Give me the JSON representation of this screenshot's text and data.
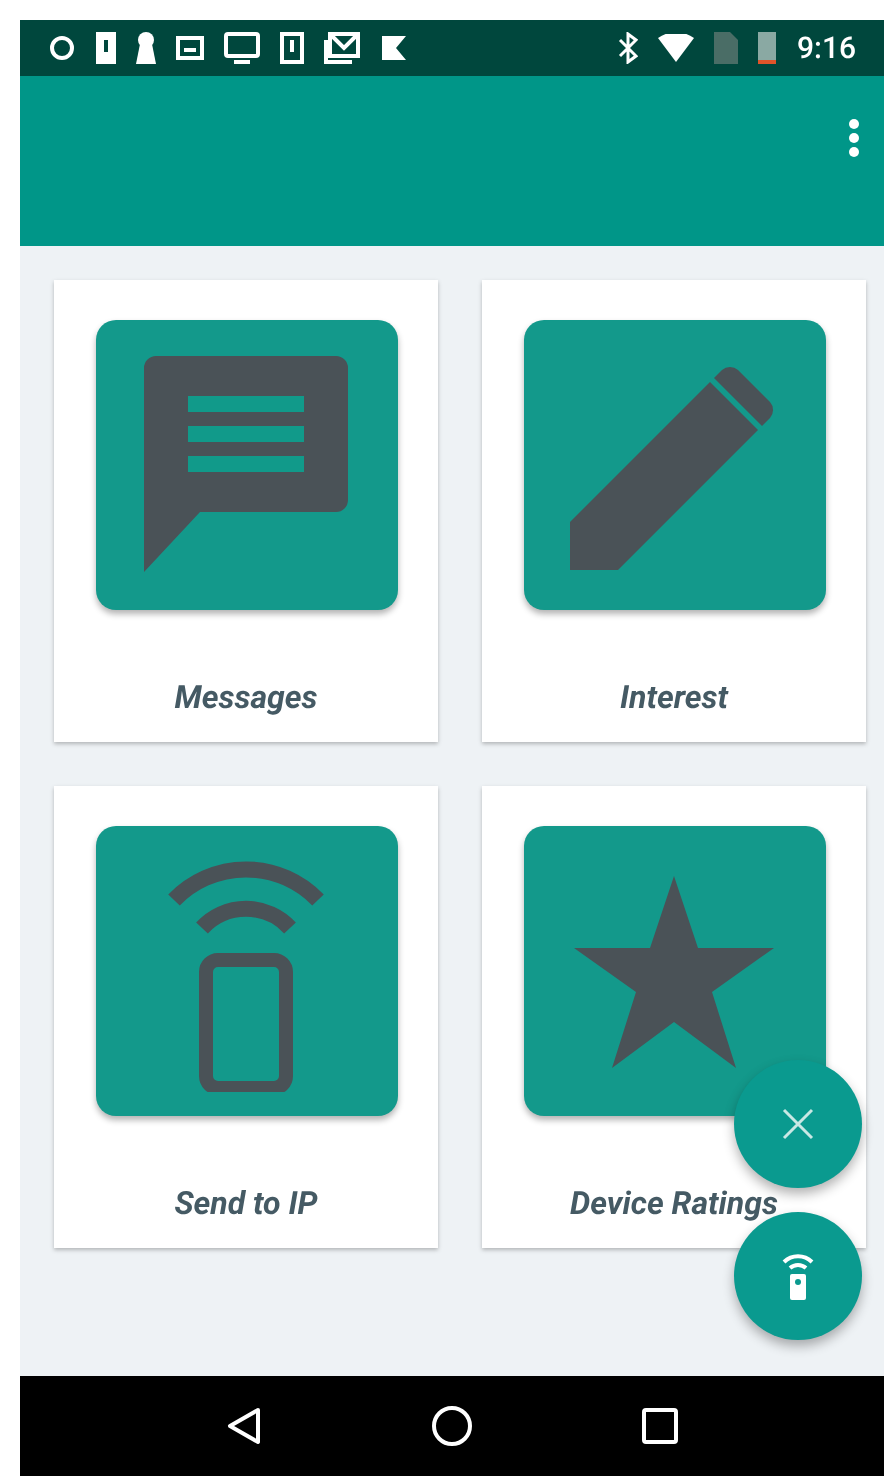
{
  "status_bar": {
    "time": "9:16"
  },
  "tiles": [
    {
      "kind": "messages",
      "label": "Messages"
    },
    {
      "kind": "edit",
      "label": "Interest"
    },
    {
      "kind": "signal",
      "label": "Send to IP"
    },
    {
      "kind": "star",
      "label": "Device Ratings"
    }
  ]
}
